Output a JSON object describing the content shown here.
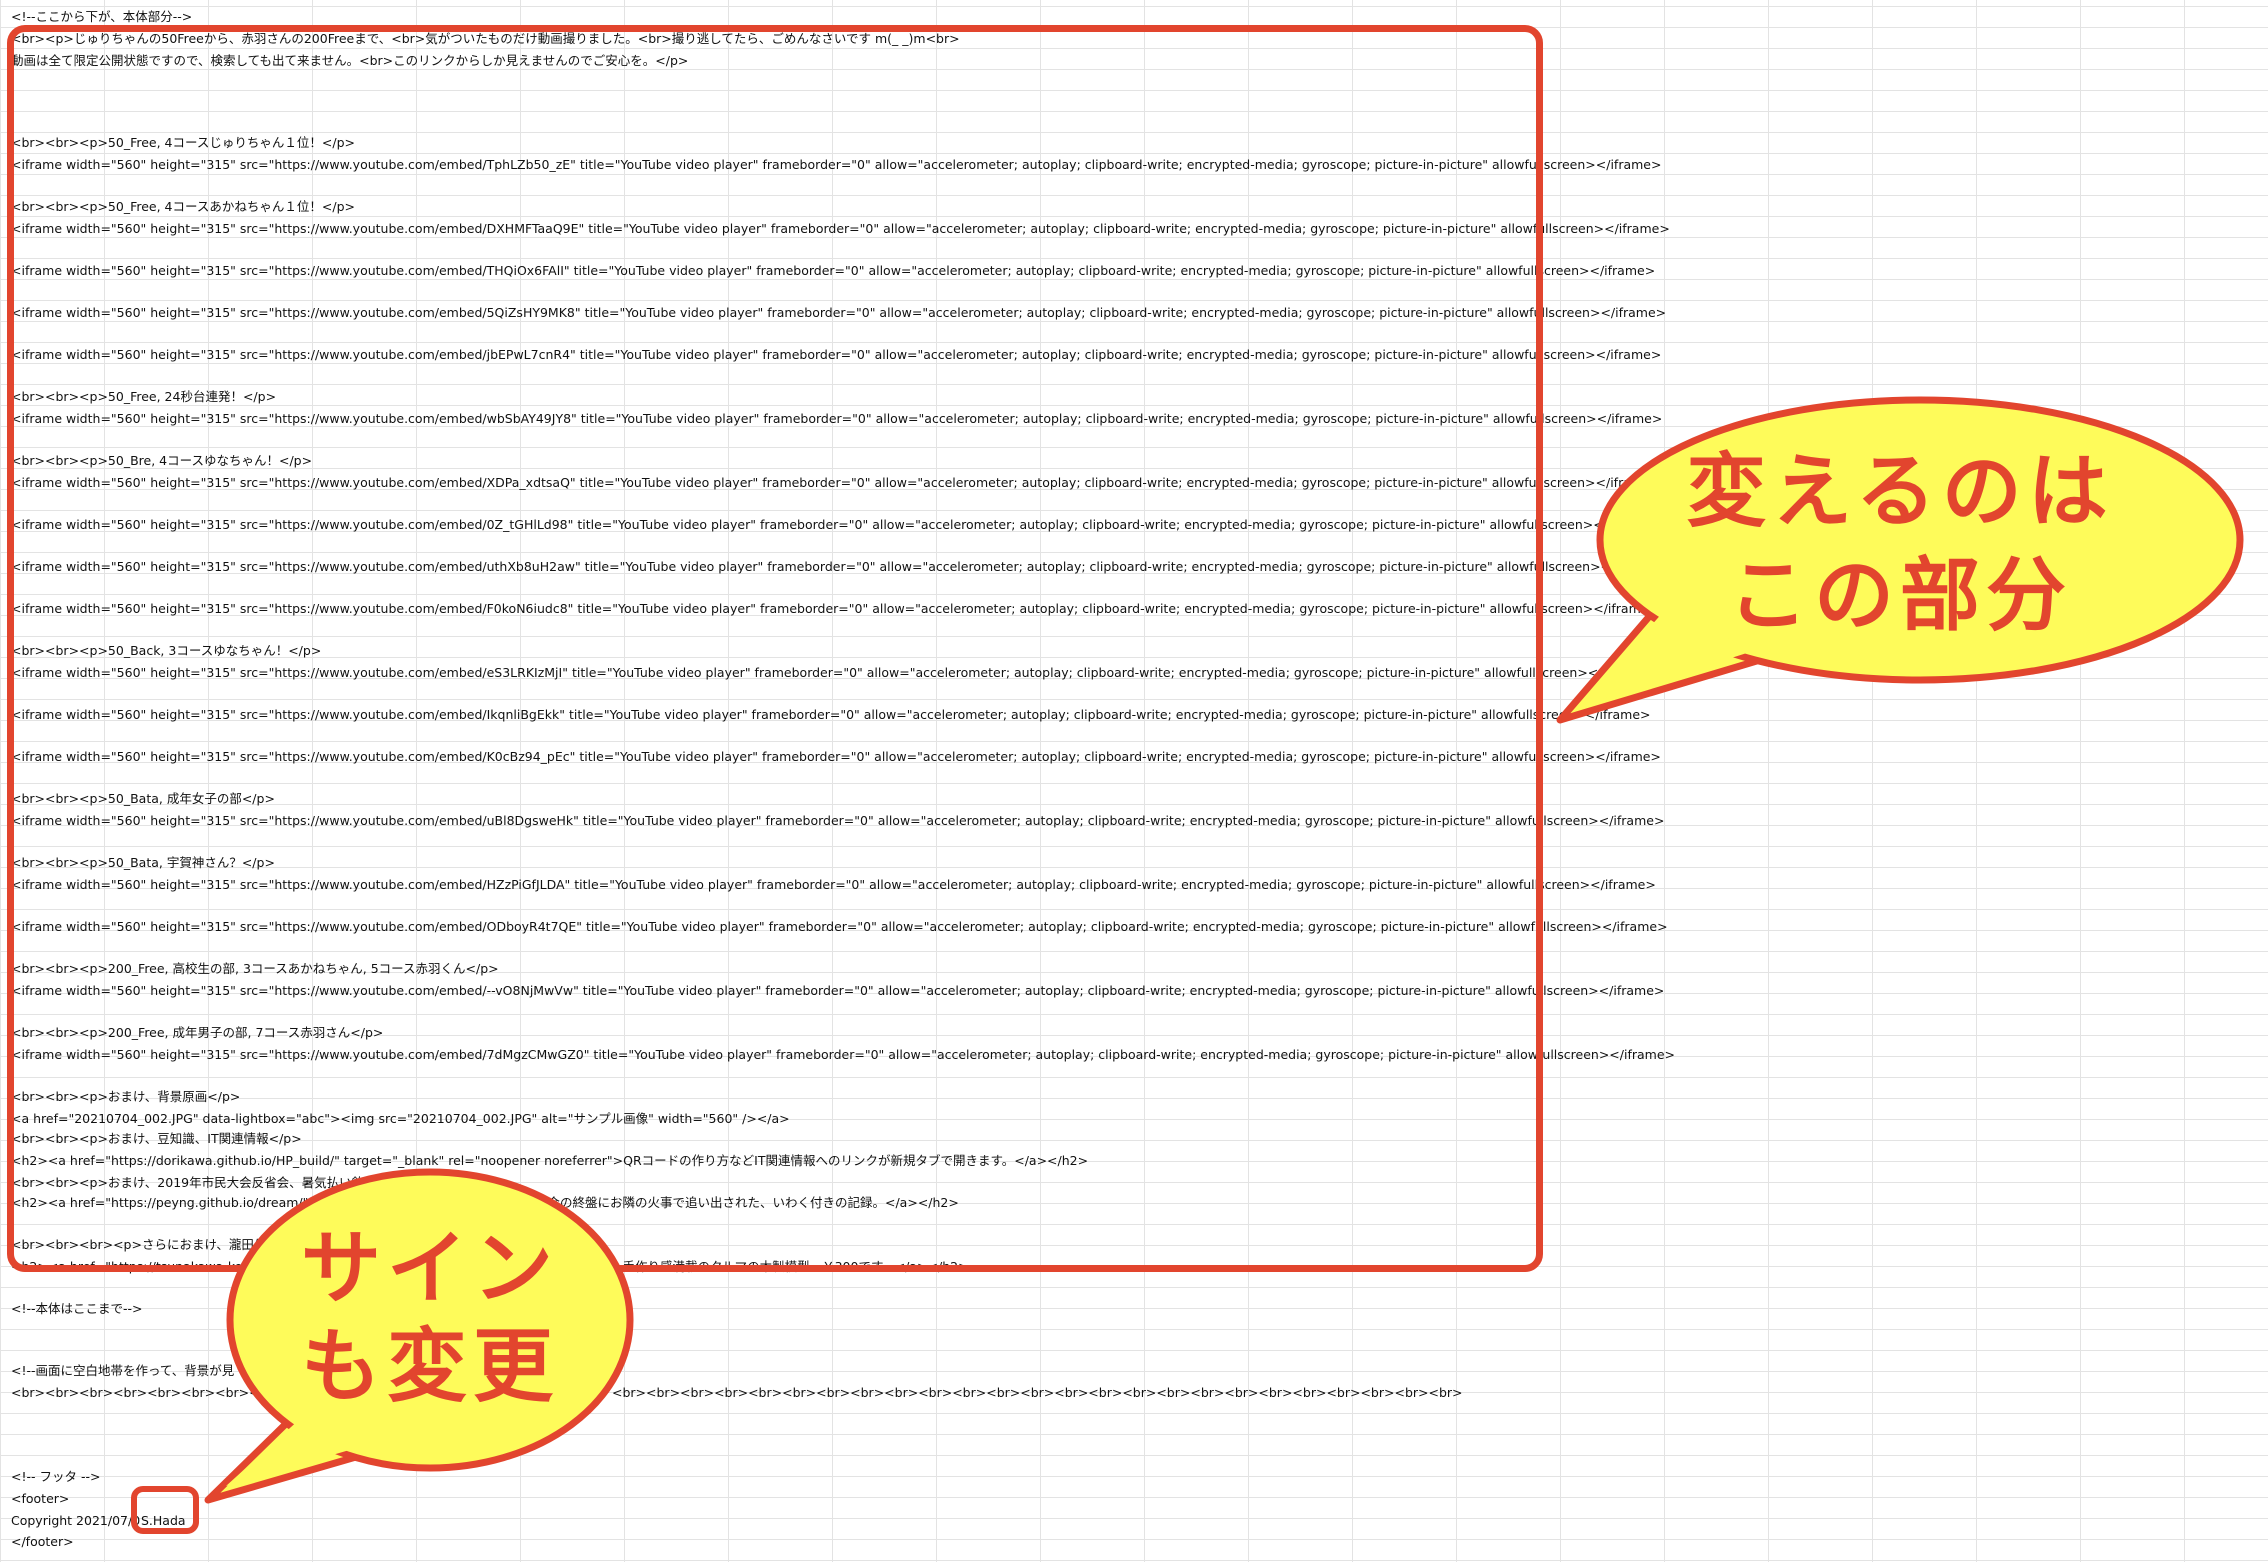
{
  "sheet": {
    "rows": [
      {
        "id": "r1",
        "text": "<!--ここから下が、本体部分-->"
      },
      {
        "id": "r2",
        "text": "<br><p>じゅりちゃんの50Freeから、赤羽さんの200Freeまで、<br>気がついたものだけ動画撮りました。<br>撮り逃してたら、ごめんなさいです m(_ _)m<br>"
      },
      {
        "id": "r3",
        "text": "動画は全て限定公開状態ですので、検索しても出て来ません。<br>このリンクからしか見えませんのでご安心を。</p>"
      },
      {
        "id": "r4",
        "text": "<br><br><p>50_Free, 4コースじゅりちゃん１位！</p>"
      },
      {
        "id": "r5",
        "text": "<iframe width=\"560\" height=\"315\" src=\"https://www.youtube.com/embed/TphLZb50_zE\" title=\"YouTube video player\" frameborder=\"0\" allow=\"accelerometer; autoplay; clipboard-write; encrypted-media; gyroscope; picture-in-picture\" allowfullscreen></iframe>"
      },
      {
        "id": "r6",
        "text": "<br><br><p>50_Free, 4コースあかねちゃん１位！</p>"
      },
      {
        "id": "r7",
        "text": "<iframe width=\"560\" height=\"315\" src=\"https://www.youtube.com/embed/DXHMFTaaQ9E\" title=\"YouTube video player\" frameborder=\"0\" allow=\"accelerometer; autoplay; clipboard-write; encrypted-media; gyroscope; picture-in-picture\" allowfullscreen></iframe>"
      },
      {
        "id": "r8",
        "text": "<iframe width=\"560\" height=\"315\" src=\"https://www.youtube.com/embed/THQiOx6FAlI\" title=\"YouTube video player\" frameborder=\"0\" allow=\"accelerometer; autoplay; clipboard-write; encrypted-media; gyroscope; picture-in-picture\" allowfullscreen></iframe>"
      },
      {
        "id": "r9",
        "text": "<iframe width=\"560\" height=\"315\" src=\"https://www.youtube.com/embed/5QiZsHY9MK8\" title=\"YouTube video player\" frameborder=\"0\" allow=\"accelerometer; autoplay; clipboard-write; encrypted-media; gyroscope; picture-in-picture\" allowfullscreen></iframe>"
      },
      {
        "id": "r10",
        "text": "<iframe width=\"560\" height=\"315\" src=\"https://www.youtube.com/embed/jbEPwL7cnR4\" title=\"YouTube video player\" frameborder=\"0\" allow=\"accelerometer; autoplay; clipboard-write; encrypted-media; gyroscope; picture-in-picture\" allowfullscreen></iframe>"
      },
      {
        "id": "r11",
        "text": "<br><br><p>50_Free, 24秒台連発！</p>"
      },
      {
        "id": "r12",
        "text": "<iframe width=\"560\" height=\"315\" src=\"https://www.youtube.com/embed/wbSbAY49JY8\" title=\"YouTube video player\" frameborder=\"0\" allow=\"accelerometer; autoplay; clipboard-write; encrypted-media; gyroscope; picture-in-picture\" allowfullscreen></iframe>"
      },
      {
        "id": "r13",
        "text": "<br><br><p>50_Bre, 4コースゆなちゃん！</p>"
      },
      {
        "id": "r14",
        "text": "<iframe width=\"560\" height=\"315\" src=\"https://www.youtube.com/embed/XDPa_xdtsaQ\" title=\"YouTube video player\" frameborder=\"0\" allow=\"accelerometer; autoplay; clipboard-write; encrypted-media; gyroscope; picture-in-picture\" allowfullscreen></iframe>"
      },
      {
        "id": "r15",
        "text": "<iframe width=\"560\" height=\"315\" src=\"https://www.youtube.com/embed/0Z_tGHlLd98\" title=\"YouTube video player\" frameborder=\"0\" allow=\"accelerometer; autoplay; clipboard-write; encrypted-media; gyroscope; picture-in-picture\" allowfullscreen></iframe>"
      },
      {
        "id": "r16",
        "text": "<iframe width=\"560\" height=\"315\" src=\"https://www.youtube.com/embed/uthXb8uH2aw\" title=\"YouTube video player\" frameborder=\"0\" allow=\"accelerometer; autoplay; clipboard-write; encrypted-media; gyroscope; picture-in-picture\" allowfullscreen></iframe>"
      },
      {
        "id": "r17",
        "text": "<iframe width=\"560\" height=\"315\" src=\"https://www.youtube.com/embed/F0koN6iudc8\" title=\"YouTube video player\" frameborder=\"0\" allow=\"accelerometer; autoplay; clipboard-write; encrypted-media; gyroscope; picture-in-picture\" allowfullscreen></iframe>"
      },
      {
        "id": "r18",
        "text": "<br><br><p>50_Back, 3コースゆなちゃん！</p>"
      },
      {
        "id": "r19",
        "text": "<iframe width=\"560\" height=\"315\" src=\"https://www.youtube.com/embed/eS3LRKIzMjI\" title=\"YouTube video player\" frameborder=\"0\" allow=\"accelerometer; autoplay; clipboard-write; encrypted-media; gyroscope; picture-in-picture\" allowfullscreen></iframe>"
      },
      {
        "id": "r20",
        "text": "<iframe width=\"560\" height=\"315\" src=\"https://www.youtube.com/embed/IkqnliBgEkk\" title=\"YouTube video player\" frameborder=\"0\" allow=\"accelerometer; autoplay; clipboard-write; encrypted-media; gyroscope; picture-in-picture\" allowfullscreen></iframe>"
      },
      {
        "id": "r21",
        "text": "<iframe width=\"560\" height=\"315\" src=\"https://www.youtube.com/embed/K0cBz94_pEc\" title=\"YouTube video player\" frameborder=\"0\" allow=\"accelerometer; autoplay; clipboard-write; encrypted-media; gyroscope; picture-in-picture\" allowfullscreen></iframe>"
      },
      {
        "id": "r22",
        "text": "<br><br><p>50_Bata, 成年女子の部</p>"
      },
      {
        "id": "r23",
        "text": "<iframe width=\"560\" height=\"315\" src=\"https://www.youtube.com/embed/uBl8DgsweHk\" title=\"YouTube video player\" frameborder=\"0\" allow=\"accelerometer; autoplay; clipboard-write; encrypted-media; gyroscope; picture-in-picture\" allowfullscreen></iframe>"
      },
      {
        "id": "r24",
        "text": "<br><br><p>50_Bata, 宇賀神さん？</p>"
      },
      {
        "id": "r25",
        "text": "<iframe width=\"560\" height=\"315\" src=\"https://www.youtube.com/embed/HZzPiGfJLDA\" title=\"YouTube video player\" frameborder=\"0\" allow=\"accelerometer; autoplay; clipboard-write; encrypted-media; gyroscope; picture-in-picture\" allowfullscreen></iframe>"
      },
      {
        "id": "r26",
        "text": "<iframe width=\"560\" height=\"315\" src=\"https://www.youtube.com/embed/ODboyR4t7QE\" title=\"YouTube video player\" frameborder=\"0\" allow=\"accelerometer; autoplay; clipboard-write; encrypted-media; gyroscope; picture-in-picture\" allowfullscreen></iframe>"
      },
      {
        "id": "r27",
        "text": "<br><br><p>200_Free, 高校生の部, 3コースあかねちゃん, 5コース赤羽くん</p>"
      },
      {
        "id": "r28",
        "text": "<iframe width=\"560\" height=\"315\" src=\"https://www.youtube.com/embed/--vO8NjMwVw\" title=\"YouTube video player\" frameborder=\"0\" allow=\"accelerometer; autoplay; clipboard-write; encrypted-media; gyroscope; picture-in-picture\" allowfullscreen></iframe>"
      },
      {
        "id": "r29",
        "text": "<br><br><p>200_Free, 成年男子の部, 7コース赤羽さん</p>"
      },
      {
        "id": "r30",
        "text": "<iframe width=\"560\" height=\"315\" src=\"https://www.youtube.com/embed/7dMgzCMwGZ0\" title=\"YouTube video player\" frameborder=\"0\" allow=\"accelerometer; autoplay; clipboard-write; encrypted-media; gyroscope; picture-in-picture\" allowfullscreen></iframe>"
      },
      {
        "id": "r31",
        "text": "<br><br><p>おまけ、背景原画</p>"
      },
      {
        "id": "r32",
        "text": "<a href=\"20210704_002.JPG\" data-lightbox=\"abc\"><img src=\"20210704_002.JPG\" alt=\"サンプル画像\" width=\"560\" /></a>"
      },
      {
        "id": "r33",
        "text": "<br><br><p>おまけ、豆知識、IT関連情報</p>"
      },
      {
        "id": "r34",
        "text": "<h2><a href=\"https://dorikawa.github.io/HP_build/\" target=\"_blank\" rel=\"noopener noreferrer\">QRコードの作り方などIT関連情報へのリンクが新規タブで開きます。</a></h2>"
      },
      {
        "id": "r35",
        "text": "<br><br><p>おまけ、2019年市民大会反省会、暑気払い飲"
      },
      {
        "id": "r36",
        "text": "<h2><a href=\"https://peyng.github.io/dream/\" targ"
      },
      {
        "id": "r36b",
        "text": "省会の終盤にお隣の火事で追い出された、いわく付きの記録。</a></h2>"
      },
      {
        "id": "r37",
        "text": "<br><br><br><p>さらにおまけ、瀧田先生"
      },
      {
        "id": "r38",
        "text": "<h2><a href=\"https://tsunakawa-konpou"
      },
      {
        "id": "r38b",
        "text": ">手作り感満載のクルマの木製模型、￥300です。</a></h2>"
      },
      {
        "id": "r39",
        "text": "<!--本体はここまで-->"
      },
      {
        "id": "r40",
        "text": "<!--画面に空白地帯を作って、背景が見"
      },
      {
        "id": "r41",
        "text": "<br><br><br><br><br><br><br><br><br>"
      },
      {
        "id": "r41b",
        "text": "<br><br><br><br><br><br><br><br><br><br><br><br><br><br><br><br><br><br><br><br><br><br><br><br><br>"
      },
      {
        "id": "r42",
        "text": "<!-- フッタ -->"
      },
      {
        "id": "r43",
        "text": "<footer>"
      },
      {
        "id": "r44",
        "text": "Copyright 2021/07/0"
      },
      {
        "id": "r44b",
        "text": "S.Hada"
      },
      {
        "id": "r45",
        "text": "</footer>"
      }
    ]
  },
  "callouts": {
    "main": {
      "line1": "変えるのは",
      "line2": "この部分"
    },
    "signature": {
      "line1": "サイン",
      "line2": "も変更"
    }
  },
  "colors": {
    "annotation_red": "#e2452e",
    "bubble_yellow": "#fefb5a",
    "grid": "#e3e3e3"
  }
}
